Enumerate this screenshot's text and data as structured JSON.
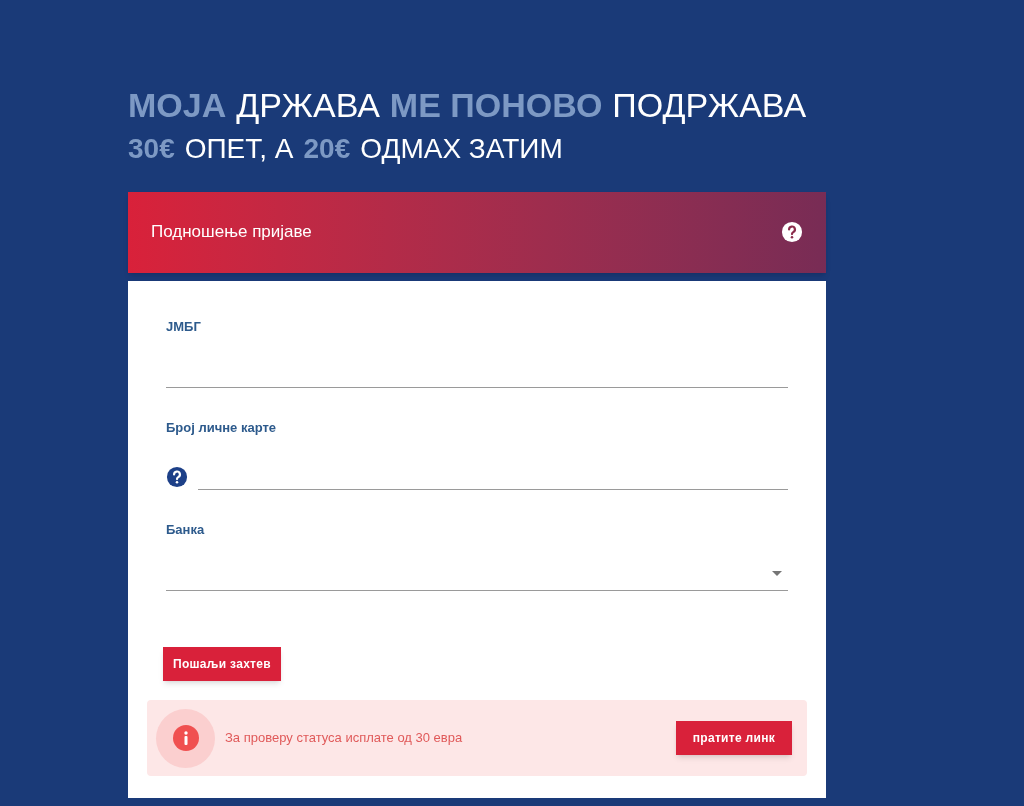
{
  "headline": {
    "line_1": [
      {
        "text": "МОЈА",
        "highlight": true
      },
      {
        "text": "ДРЖАВА",
        "highlight": false
      },
      {
        "text": "МЕ ПОНОВО",
        "highlight": true
      },
      {
        "text": "ПОДРЖАВА",
        "highlight": false
      }
    ],
    "line_2": [
      {
        "text": "30€",
        "highlight": true
      },
      {
        "text": "ОПЕТ, А",
        "highlight": false
      },
      {
        "text": "20€",
        "highlight": true
      },
      {
        "text": "ОДМАХ ЗАТИМ",
        "highlight": false
      }
    ]
  },
  "form_header": {
    "title": "Подношење пријаве"
  },
  "fields": [
    {
      "kind": "text",
      "label": "ЈМБГ"
    },
    {
      "kind": "help",
      "label": "Број личне карте"
    },
    {
      "kind": "select",
      "label": "Банка"
    }
  ],
  "submit_button": "Пошаљи захтев",
  "alert": {
    "message": "За проверу статуса исплате од 30 евра",
    "button": "пратите линк"
  }
}
